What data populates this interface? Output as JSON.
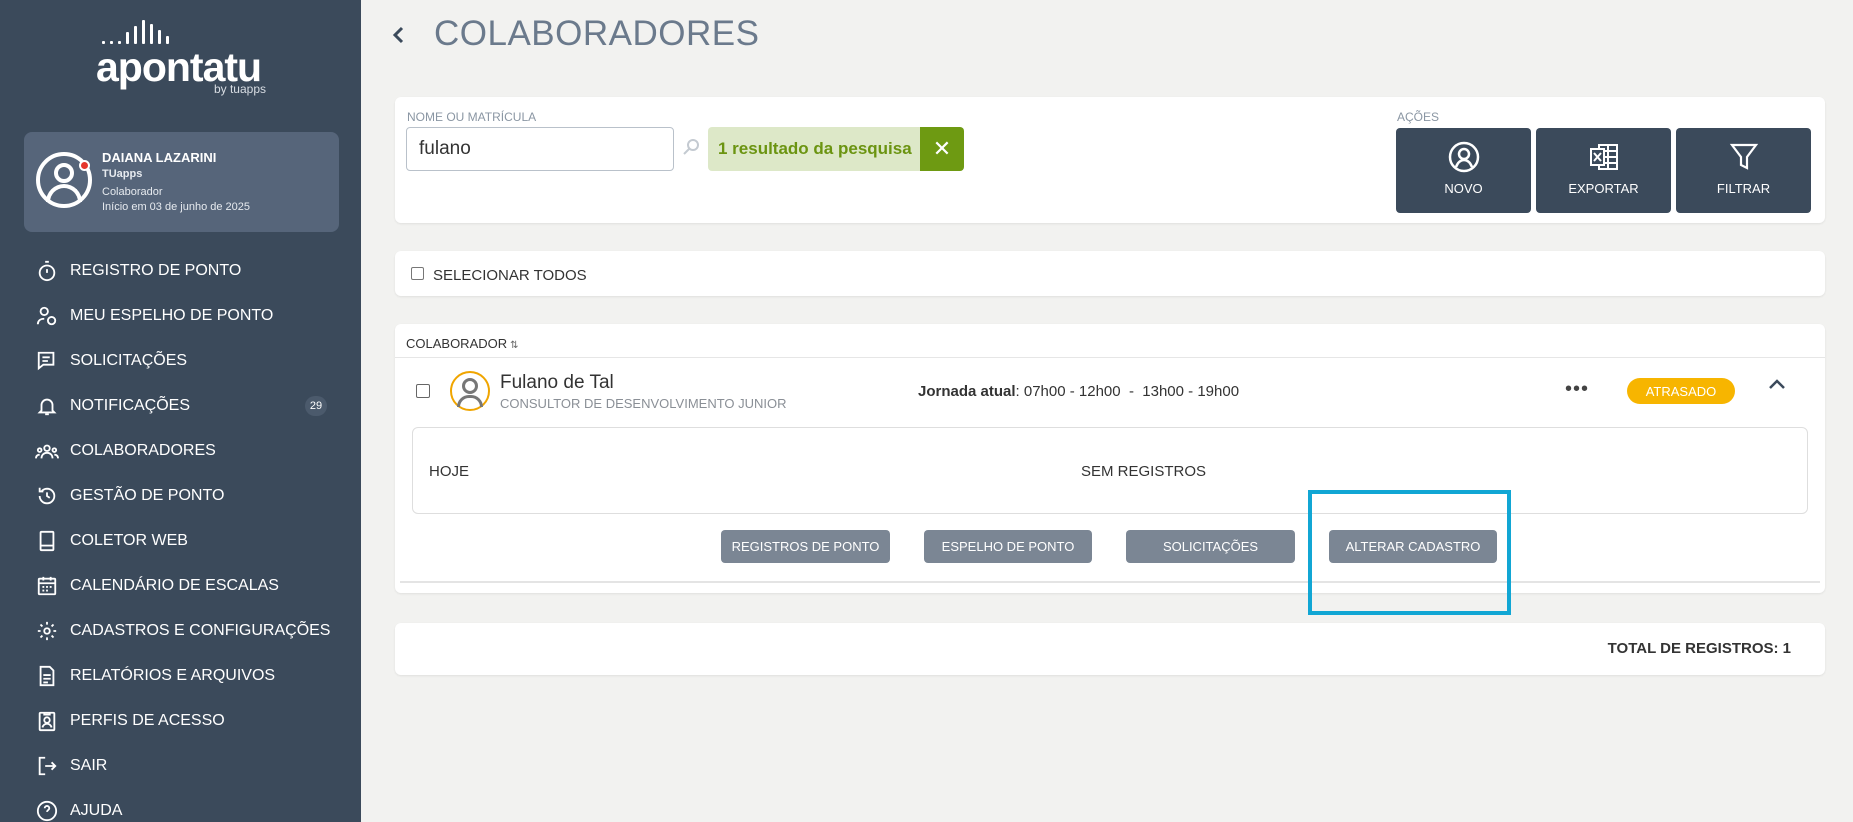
{
  "app": {
    "logo_text": "apontatu",
    "logo_by": "by tuapps"
  },
  "profile": {
    "name": "DAIANA LAZARINI",
    "company": "TUapps",
    "role": "Colaborador",
    "since": "Início em 03 de junho de 2025"
  },
  "nav": [
    {
      "label": "REGISTRO DE PONTO",
      "icon": "stopwatch-icon"
    },
    {
      "label": "MEU ESPELHO DE PONTO",
      "icon": "user-clock-icon"
    },
    {
      "label": "SOLICITAÇÕES",
      "icon": "request-icon"
    },
    {
      "label": "NOTIFICAÇÕES",
      "icon": "bell-icon",
      "badge": "29"
    },
    {
      "label": "COLABORADORES",
      "icon": "users-icon"
    },
    {
      "label": "GESTÃO DE PONTO",
      "icon": "history-icon"
    },
    {
      "label": "COLETOR WEB",
      "icon": "tablet-icon"
    },
    {
      "label": "CALENDÁRIO DE ESCALAS",
      "icon": "calendar-icon"
    },
    {
      "label": "CADASTROS E CONFIGURAÇÕES",
      "icon": "gear-icon"
    },
    {
      "label": "RELATÓRIOS E ARQUIVOS",
      "icon": "document-icon"
    },
    {
      "label": "PERFIS DE ACESSO",
      "icon": "id-badge-icon"
    },
    {
      "label": "SAIR",
      "icon": "logout-icon"
    },
    {
      "label": "AJUDA",
      "icon": "help-icon"
    }
  ],
  "page": {
    "title": "COLABORADORES"
  },
  "search": {
    "label": "NOME OU MATRÍCULA",
    "value": "fulano",
    "result_text": "1 resultado da pesquisa",
    "clear": "✕"
  },
  "actions": {
    "label": "AÇÕES",
    "buttons": [
      {
        "label": "NOVO",
        "icon": "user-add-icon"
      },
      {
        "label": "EXPORTAR",
        "icon": "excel-icon"
      },
      {
        "label": "FILTRAR",
        "icon": "filter-icon"
      }
    ]
  },
  "select_all": {
    "label": "SELECIONAR TODOS"
  },
  "list": {
    "column_header": "COLABORADOR",
    "employee": {
      "name": "Fulano de Tal",
      "role": "CONSULTOR DE DESENVOLVIMENTO JUNIOR",
      "jornada_label": "Jornada atual",
      "jornada_value": ": 07h00 - 12h00  -  13h00 - 19h00",
      "more": "•••",
      "status": "ATRASADO",
      "status_color": "#f7b500"
    },
    "today": {
      "label": "HOJE",
      "value": "SEM REGISTROS"
    },
    "row_buttons": [
      "REGISTROS DE PONTO",
      "ESPELHO DE PONTO",
      "SOLICITAÇÕES",
      "ALTERAR CADASTRO"
    ]
  },
  "total": {
    "text": "TOTAL DE REGISTROS: 1"
  },
  "colors": {
    "sidebar": "#3b4a5b",
    "accent_green": "#6e9a12",
    "highlight": "#11a6d4"
  }
}
